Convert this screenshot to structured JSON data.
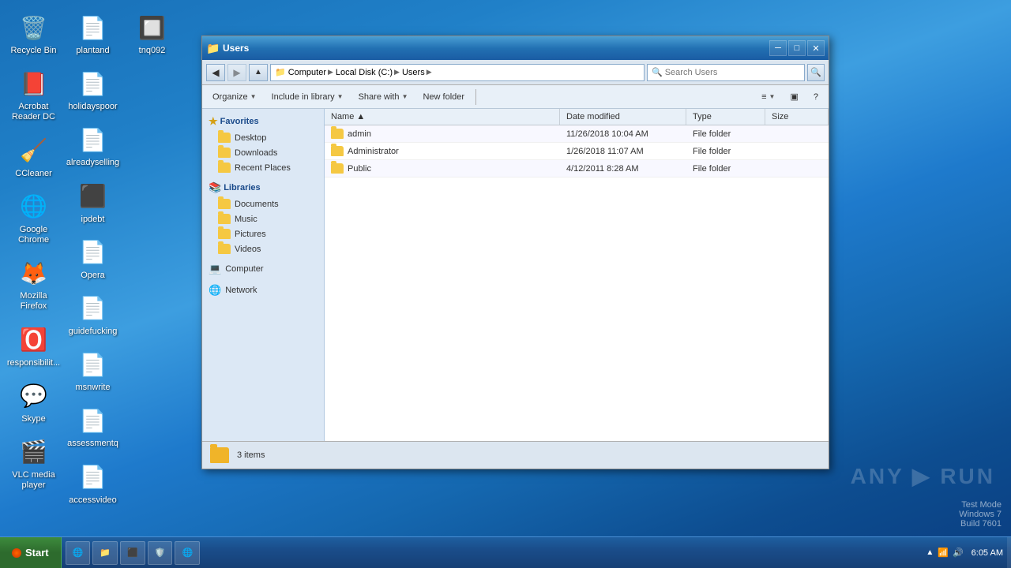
{
  "desktop": {
    "icons": [
      {
        "id": "recycle-bin",
        "label": "Recycle Bin",
        "icon": "🗑️"
      },
      {
        "id": "vlc",
        "label": "VLC media player",
        "icon": "🎬"
      },
      {
        "id": "msnwrite",
        "label": "msnwrite",
        "icon": "📄"
      },
      {
        "id": "acrobat",
        "label": "Acrobat Reader DC",
        "icon": "📕"
      },
      {
        "id": "plantand",
        "label": "plantand",
        "icon": "📄"
      },
      {
        "id": "assessmentq",
        "label": "assessmentq",
        "icon": "📄"
      },
      {
        "id": "ccleaner",
        "label": "CCleaner",
        "icon": "🧹"
      },
      {
        "id": "holidayspoor",
        "label": "holidayspoor",
        "icon": "📄"
      },
      {
        "id": "accessvideo",
        "label": "accessvideo",
        "icon": "📄"
      },
      {
        "id": "chrome",
        "label": "Google Chrome",
        "icon": "🌐"
      },
      {
        "id": "alreadyselling",
        "label": "alreadyselling",
        "icon": "📄"
      },
      {
        "id": "tnq092",
        "label": "tnq092",
        "icon": "🔲"
      },
      {
        "id": "firefox",
        "label": "Mozilla Firefox",
        "icon": "🦊"
      },
      {
        "id": "ipdebt",
        "label": "ipdebt",
        "icon": "⬛"
      },
      {
        "id": "opera",
        "label": "Opera",
        "icon": "🅾️"
      },
      {
        "id": "responsibilit",
        "label": "responsibilit...",
        "icon": "📄"
      },
      {
        "id": "skype",
        "label": "Skype",
        "icon": "💬"
      },
      {
        "id": "guidefucking",
        "label": "guidefucking",
        "icon": "📄"
      }
    ]
  },
  "window": {
    "title": "Users",
    "title_icon": "📁"
  },
  "address_bar": {
    "segments": [
      "Computer",
      "Local Disk (C:)",
      "Users"
    ],
    "search_placeholder": "Search Users",
    "search_label": "Search Users"
  },
  "toolbar": {
    "organize_label": "Organize",
    "include_label": "Include in library",
    "share_label": "Share with",
    "new_folder_label": "New folder"
  },
  "sidebar": {
    "favorites_label": "Favorites",
    "favorites_items": [
      {
        "id": "desktop",
        "label": "Desktop"
      },
      {
        "id": "downloads",
        "label": "Downloads"
      },
      {
        "id": "recent-places",
        "label": "Recent Places"
      }
    ],
    "libraries_label": "Libraries",
    "libraries_items": [
      {
        "id": "documents",
        "label": "Documents"
      },
      {
        "id": "music",
        "label": "Music"
      },
      {
        "id": "pictures",
        "label": "Pictures"
      },
      {
        "id": "videos",
        "label": "Videos"
      }
    ],
    "computer_label": "Computer",
    "network_label": "Network"
  },
  "file_list": {
    "columns": [
      "Name",
      "Date modified",
      "Type",
      "Size"
    ],
    "files": [
      {
        "name": "admin",
        "date": "11/26/2018 10:04 AM",
        "type": "File folder",
        "size": ""
      },
      {
        "name": "Administrator",
        "date": "1/26/2018 11:07 AM",
        "type": "File folder",
        "size": ""
      },
      {
        "name": "Public",
        "date": "4/12/2011 8:28 AM",
        "type": "File folder",
        "size": ""
      }
    ]
  },
  "status_bar": {
    "item_count": "3 items"
  },
  "taskbar": {
    "start_label": "Start",
    "time": "6:05 AM",
    "date": "6:05 AM",
    "os_label": "Windows 7",
    "items": [
      {
        "id": "ie",
        "label": "IE",
        "icon": "🌐"
      },
      {
        "id": "explorer",
        "label": "Explorer",
        "icon": "📁"
      },
      {
        "id": "unknown1",
        "label": "",
        "icon": "🔲"
      },
      {
        "id": "unknown2",
        "label": "",
        "icon": "🛡️"
      },
      {
        "id": "chrome-tb",
        "label": "",
        "icon": "🌐"
      }
    ]
  },
  "watermark": {
    "line1": "Test Mode",
    "line2": "Windows 7",
    "line3": "Build 7601"
  },
  "anyrun": {
    "label": "ANY ▶ RUN"
  }
}
